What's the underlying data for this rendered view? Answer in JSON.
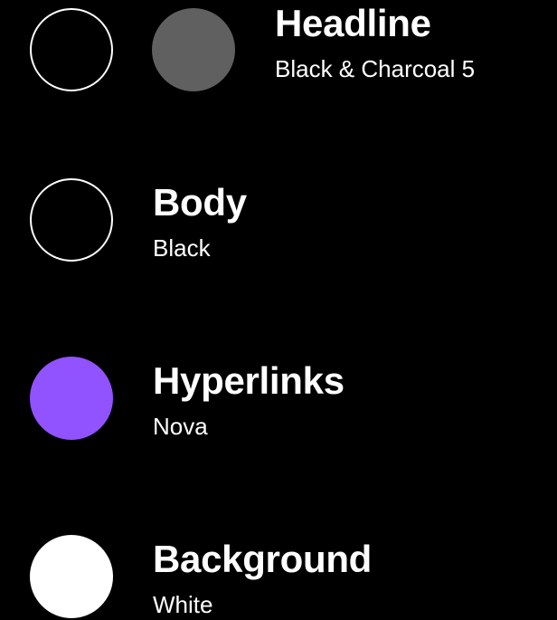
{
  "rows": [
    {
      "title": "Headline",
      "subtitle": "Black & Charcoal 5",
      "swatches": [
        {
          "name": "Black",
          "fill": "#000000",
          "outline": "#ffffff"
        },
        {
          "name": "Charcoal 5",
          "fill": "#606060"
        }
      ]
    },
    {
      "title": "Body",
      "subtitle": "Black",
      "swatches": [
        {
          "name": "Black",
          "fill": "#000000",
          "outline": "#ffffff"
        }
      ]
    },
    {
      "title": "Hyperlinks",
      "subtitle": "Nova",
      "swatches": [
        {
          "name": "Nova",
          "fill": "#9152ff"
        }
      ]
    },
    {
      "title": "Background",
      "subtitle": "White",
      "swatches": [
        {
          "name": "White",
          "fill": "#ffffff"
        }
      ]
    }
  ]
}
